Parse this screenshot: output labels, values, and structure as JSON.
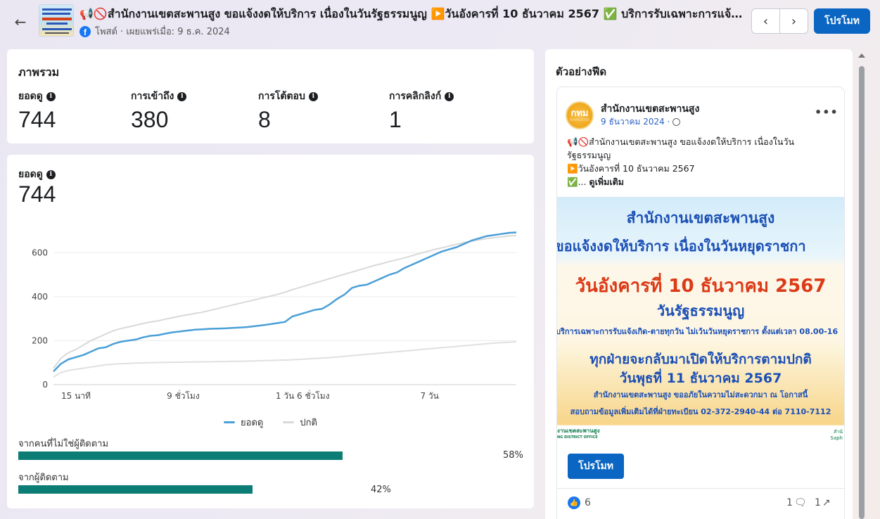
{
  "header": {
    "post_title": "📢🚫สำนักงานเขตสะพานสูง ขอแจ้งงดให้บริการ เนื่องในวันรัฐธรรมนูญ ▶️วันอังคารที่ 10 ธันวาคม 2567 ✅ บริการรับเฉพาะการแจ้งเกิด-ตายทุกวัน ไม่เว้นวันหยุดราชการ",
    "post_meta": "โพสต์ · เผยแพร่เมื่อ: 9 ธ.ค. 2024",
    "promote_label": "โปรโมท"
  },
  "overview": {
    "title": "ภาพรวม",
    "metrics": [
      {
        "label": "ยอดดู",
        "value": "744"
      },
      {
        "label": "การเข้าถึง",
        "value": "380"
      },
      {
        "label": "การโต้ตอบ",
        "value": "8"
      },
      {
        "label": "การคลิกลิงก์",
        "value": "1"
      }
    ]
  },
  "views": {
    "label": "ยอดดู",
    "value": "744"
  },
  "chart_data": {
    "type": "line",
    "x": [
      0,
      1,
      2,
      3,
      4,
      5,
      6,
      7,
      8,
      9,
      10,
      11,
      12,
      13,
      14,
      15,
      16,
      17,
      18,
      19,
      20,
      21,
      22,
      23,
      24,
      25,
      26,
      27,
      28,
      29,
      30,
      31,
      32,
      33,
      34,
      35,
      36,
      37,
      38,
      39,
      40,
      41,
      42,
      43,
      44,
      45,
      46,
      47,
      48,
      49,
      50,
      51,
      52,
      53,
      54,
      55,
      56,
      57,
      58,
      59,
      60,
      61,
      62
    ],
    "xtick_labels": [
      "15 นาที",
      "9 ชั่วโมง",
      "1 วัน 6 ชั่วโมง",
      "7 วัน"
    ],
    "xtick_positions": [
      0,
      17,
      33,
      50
    ],
    "yticks": [
      0,
      200,
      400,
      600
    ],
    "ylim": [
      0,
      700
    ],
    "grid": true,
    "legend_position": "bottom",
    "series": [
      {
        "name": "ยอดดู",
        "color": "#4a9fd8",
        "values": [
          60,
          95,
          115,
          125,
          135,
          150,
          165,
          170,
          185,
          195,
          200,
          205,
          215,
          222,
          225,
          232,
          238,
          242,
          246,
          250,
          252,
          254,
          255,
          256,
          258,
          260,
          262,
          266,
          270,
          275,
          280,
          285,
          310,
          320,
          330,
          340,
          345,
          365,
          390,
          410,
          440,
          450,
          455,
          470,
          485,
          500,
          510,
          530,
          545,
          560,
          575,
          590,
          605,
          615,
          625,
          640,
          655,
          665,
          675,
          680,
          685,
          690,
          692
        ]
      },
      {
        "name": "ปกติ",
        "color": "#d9d9d9",
        "values": [
          75,
          120,
          145,
          160,
          180,
          200,
          215,
          230,
          245,
          255,
          262,
          270,
          278,
          285,
          290,
          298,
          305,
          312,
          318,
          324,
          330,
          338,
          346,
          354,
          362,
          370,
          378,
          386,
          394,
          402,
          410,
          420,
          432,
          442,
          452,
          462,
          472,
          482,
          492,
          502,
          512,
          522,
          532,
          542,
          550,
          560,
          568,
          576,
          586,
          596,
          605,
          614,
          622,
          630,
          638,
          646,
          652,
          658,
          664,
          668,
          672,
          676,
          678
        ]
      },
      {
        "name": "",
        "color": "#e0e0e0",
        "values": [
          35,
          55,
          65,
          70,
          75,
          80,
          85,
          90,
          93,
          95,
          97,
          98,
          99,
          100,
          101,
          101,
          102,
          102,
          103,
          103,
          104,
          104,
          105,
          105,
          106,
          106,
          107,
          108,
          109,
          110,
          111,
          112,
          113,
          115,
          117,
          119,
          121,
          123,
          126,
          129,
          132,
          135,
          138,
          141,
          144,
          147,
          150,
          153,
          156,
          159,
          162,
          165,
          168,
          171,
          174,
          177,
          180,
          183,
          186,
          189,
          191,
          193,
          195
        ]
      }
    ]
  },
  "audience": [
    {
      "label": "จากคนที่ไม่ใช่ผู้ติดตาม",
      "pct_text": "58%",
      "fraction": 0.58
    },
    {
      "label": "จากผู้ติดตาม",
      "pct_text": "42%",
      "fraction": 0.42
    }
  ],
  "preview": {
    "title": "ตัวอย่างฟีด",
    "page_name": "สำนักงานเขตสะพานสูง",
    "post_date": "9 ธันวาคม 2024 ·",
    "text_line1": "📢🚫สำนักงานเขตสะพานสูง ขอแจ้งงดให้บริการ เนื่องในวัน",
    "text_line2": "รัฐธรรมนูญ",
    "text_line3": "▶️วันอังคารที่ 10 ธันวาคม 2567",
    "text_line4_prefix": "✅...",
    "see_more": "ดูเพิ่มเติม",
    "avatar_text": "กทม",
    "image": {
      "line1": "สำนักงานเขตสะพานสูง",
      "line2": "ขอแจ้งงดให้บริการ เนื่องในวันหยุดราชกา",
      "line3": "วันอังคารที่ 10 ธันวาคม 2567",
      "line4": "วันรัฐธรรมนูญ",
      "line5": "บริการเฉพาะการรับแจ้งเกิด-ตายทุกวัน ไม่เว้นวันหยุดราชการ ตั้งแต่เวลา 08.00-16",
      "line6": "ทุกฝ่ายจะกลับมาเปิดให้บริการตามปกติ",
      "line7": "วันพุธที่ 11 ธันวาคม 2567",
      "line8": "สำนักงานเขตสะพานสูง ขออภัยในความไม่สะดวกมา ณ โอกาสนี้",
      "line9": "สอบถามข้อมูลเพิ่มเติมได้ที่ฝ่ายทะเบียน 02-372-2940-44 ต่อ 7110-7112",
      "footer_left": "งานเขตสะพานสูง",
      "footer_left_sub": "NG DISTRICT OFFICE",
      "footer_right_1": "สำนั",
      "footer_right_2": "Saph"
    },
    "promote_label": "โปรโมท",
    "likes": "6",
    "comments": "1",
    "shares": "1"
  }
}
